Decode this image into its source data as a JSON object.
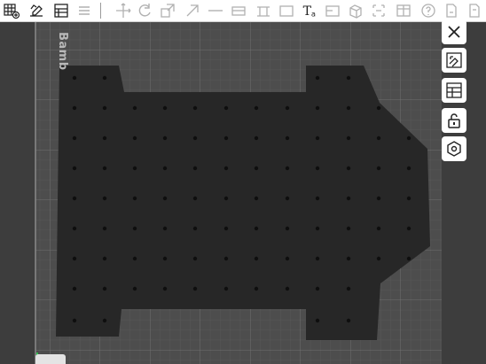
{
  "app": {
    "bed_label": "Bamb"
  },
  "toolbar": {
    "tools": [
      {
        "name": "arrange-grid-icon"
      },
      {
        "name": "place-on-face-icon"
      },
      {
        "name": "split-view-icon"
      },
      {
        "name": "layers-menu-icon"
      },
      {
        "name": "move-icon"
      },
      {
        "name": "rotate-icon"
      },
      {
        "name": "scale-icon"
      },
      {
        "name": "cut-icon"
      },
      {
        "name": "paint-icon"
      },
      {
        "name": "seam-icon"
      },
      {
        "name": "support-icon"
      },
      {
        "name": "text-tool-icon",
        "label": "T",
        "sub": "a"
      },
      {
        "name": "assembly-icon"
      },
      {
        "name": "measure-icon"
      },
      {
        "name": "boolean-icon"
      },
      {
        "name": "emboss-icon"
      },
      {
        "name": "mesh-icon"
      },
      {
        "name": "more-icon"
      }
    ]
  },
  "side_panel": {
    "buttons": [
      {
        "name": "close-icon"
      },
      {
        "name": "auto-orient-icon"
      },
      {
        "name": "layout-icon"
      },
      {
        "name": "unlock-icon"
      },
      {
        "name": "settings-hex-icon"
      }
    ]
  },
  "colors": {
    "bed": "#4d4d4d",
    "grid_minor": "#5a5a5a",
    "grid_major": "#666666",
    "part": "#272727",
    "hole": "#0e0e0e",
    "accent_green": "#2fbf4f",
    "toolbar_bg": "#ffffff"
  }
}
